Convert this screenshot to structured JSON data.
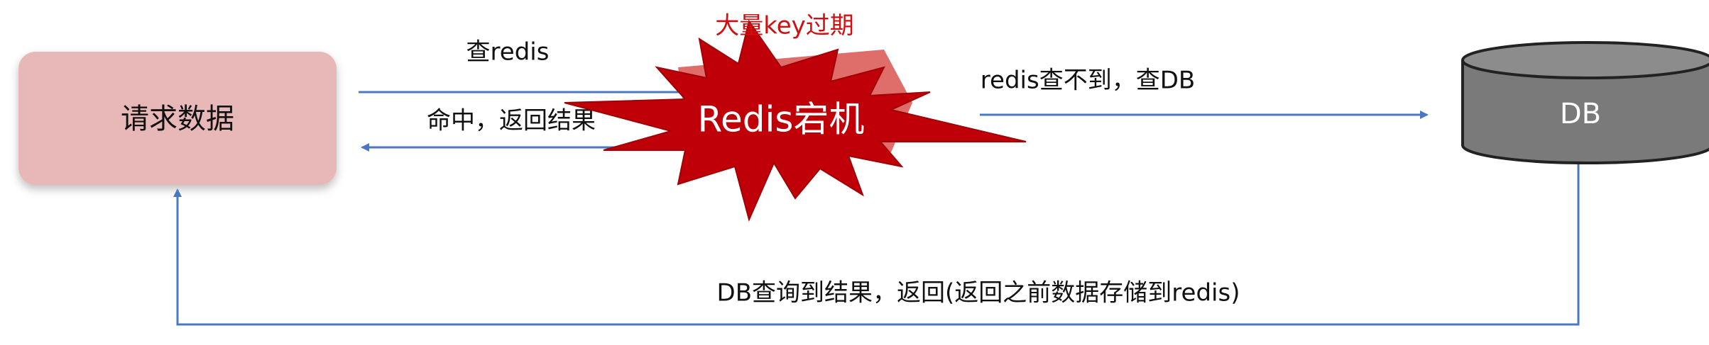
{
  "nodes": {
    "client": {
      "label": "请求数据"
    },
    "db": {
      "label": "DB"
    },
    "redis": {
      "label": "Redis宕机",
      "banner": "大量key过期"
    }
  },
  "edges": {
    "query_redis": "查redis",
    "hit_return": "命中，返回结果",
    "redis_miss": "redis查不到，查DB",
    "db_return": "DB查询到结果，返回(返回之前数据存储到redis)"
  },
  "colors": {
    "client_fill": "#e8b7b8",
    "db_fill": "#7a7a7a",
    "db_top": "#8c8c8c",
    "arrow": "#4a78c2",
    "burst": "#c00008",
    "banner": "#d01010"
  }
}
